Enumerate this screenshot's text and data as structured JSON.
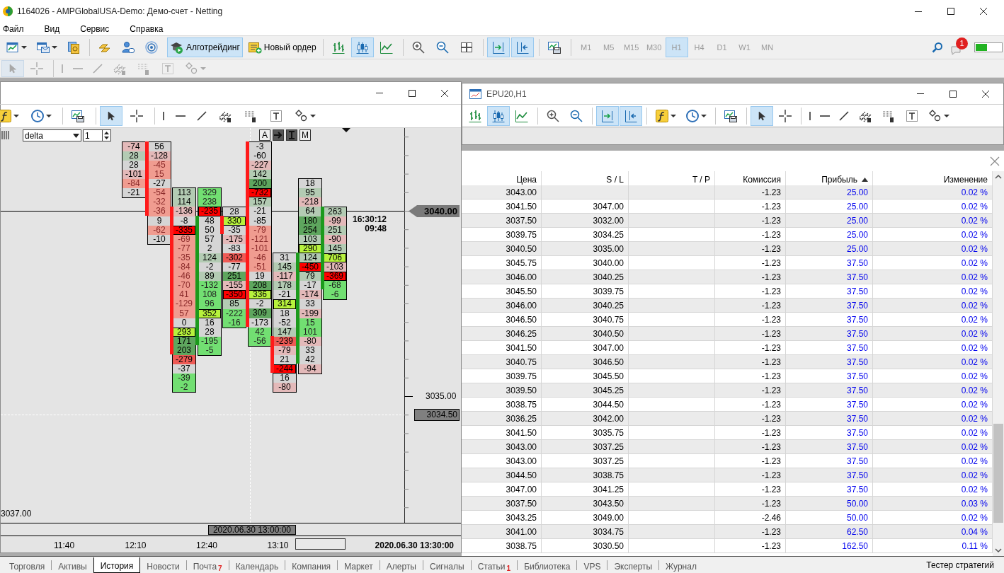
{
  "window": {
    "title": "1164026 - AMPGlobalUSA-Demo: Демо-счет - Netting"
  },
  "menu": [
    "Файл",
    "Вид",
    "Сервис",
    "Справка"
  ],
  "main_toolbar": {
    "left": [
      [
        {
          "kind": "new_chart",
          "caret": true
        },
        {
          "kind": "profiles",
          "caret": true
        },
        {
          "kind": "market"
        }
      ],
      [
        {
          "kind": "gold"
        },
        {
          "kind": "user"
        },
        {
          "kind": "waves"
        }
      ]
    ],
    "algo_button": {
      "label": "Алготрейдинг",
      "selected": true
    },
    "order_button": {
      "label": "Новый ордер"
    },
    "chart_tools": [
      [
        {
          "kind": "bars",
          "selected": false
        },
        {
          "kind": "candles",
          "selected": true
        },
        {
          "kind": "line",
          "selected": false
        }
      ],
      [
        {
          "kind": "zoom_in",
          "selected": false
        },
        {
          "kind": "zoom_out",
          "selected": false
        },
        {
          "kind": "tile",
          "selected": false
        }
      ],
      [
        {
          "kind": "autoscroll",
          "selected": true
        },
        {
          "kind": "shift",
          "selected": true
        }
      ],
      [
        {
          "kind": "template",
          "selected": false
        }
      ]
    ],
    "timeframes": [
      {
        "label": "M1",
        "selected": false,
        "disabled": true
      },
      {
        "label": "M5",
        "selected": false,
        "disabled": true
      },
      {
        "label": "M15",
        "selected": false,
        "disabled": true
      },
      {
        "label": "M30",
        "selected": false,
        "disabled": true
      },
      {
        "label": "H1",
        "selected": true,
        "disabled": true
      },
      {
        "label": "H4",
        "selected": false,
        "disabled": true
      },
      {
        "label": "D1",
        "selected": false,
        "disabled": true
      },
      {
        "label": "W1",
        "selected": false,
        "disabled": true
      },
      {
        "label": "MN",
        "selected": false,
        "disabled": true
      }
    ],
    "notification_count": "1"
  },
  "drawing_toolbar": [
    [
      {
        "kind": "cursor",
        "selected": true,
        "disabled": true
      },
      {
        "kind": "crosshair",
        "selected": false,
        "disabled": true
      }
    ],
    [
      {
        "kind": "vline",
        "selected": false,
        "disabled": true
      },
      {
        "kind": "hline",
        "selected": false,
        "disabled": true
      },
      {
        "kind": "trend",
        "selected": false,
        "disabled": true
      },
      {
        "kind": "fibo_e",
        "selected": false,
        "disabled": true
      },
      {
        "kind": "fibo_f",
        "selected": false,
        "disabled": true
      },
      {
        "kind": "text",
        "selected": false,
        "disabled": true
      },
      {
        "kind": "shapes",
        "selected": false,
        "disabled": true,
        "caret": true
      }
    ]
  ],
  "chart_window": {
    "toolbar": [
      [
        {
          "kind": "function",
          "selected": false,
          "caret": true
        },
        {
          "kind": "clock",
          "selected": false,
          "caret": true
        }
      ],
      [
        {
          "kind": "template",
          "selected": false
        }
      ],
      [
        {
          "kind": "cursor",
          "selected": true
        },
        {
          "kind": "crosshair",
          "selected": false
        }
      ],
      [
        {
          "kind": "vline",
          "selected": false
        },
        {
          "kind": "hline",
          "selected": false
        },
        {
          "kind": "trend",
          "selected": false
        },
        {
          "kind": "fibo_e",
          "selected": false
        },
        {
          "kind": "fibo_f",
          "selected": false
        },
        {
          "kind": "text",
          "selected": false
        },
        {
          "kind": "shapes",
          "selected": false,
          "caret": true
        }
      ]
    ],
    "indicator_select": "delta",
    "period": "1",
    "mode_buttons": [
      {
        "kind": "letter",
        "label": "A",
        "selected": false
      },
      {
        "kind": "arrow",
        "selected": true
      },
      {
        "kind": "ibeam",
        "selected": true
      },
      {
        "kind": "letter",
        "label": "M",
        "selected": false
      }
    ],
    "columns": [
      {
        "cells": [
          {
            "v": "-74",
            "kind": "sell"
          },
          {
            "v": "28",
            "kind": "buy"
          },
          {
            "v": "28",
            "kind": "neutral"
          },
          {
            "v": "-101",
            "kind": "sell"
          },
          {
            "v": "-84",
            "kind": "zone_sell"
          },
          {
            "v": "-21",
            "kind": "neutral"
          }
        ]
      },
      {
        "bearish": true,
        "cells": [
          {
            "v": "56",
            "kind": "neutral"
          },
          {
            "v": "-128",
            "kind": "sell"
          },
          {
            "v": "-45",
            "kind": "zone_sell"
          },
          {
            "v": "15",
            "kind": "zone_sell"
          },
          {
            "v": "-27",
            "kind": "neutral"
          },
          {
            "v": "-54",
            "kind": "zone_sell"
          },
          {
            "v": "-32",
            "kind": "zone_sell"
          },
          {
            "v": "-36",
            "kind": "zone_sell"
          },
          {
            "v": "9",
            "kind": "neutral"
          },
          {
            "v": "-62",
            "kind": "zone_sell"
          },
          {
            "v": "-10",
            "kind": "neutral"
          }
        ]
      },
      {
        "bearish": true,
        "cells": [
          {
            "v": "113",
            "kind": "buy"
          },
          {
            "v": "114",
            "kind": "buy"
          },
          {
            "v": "-136",
            "kind": "sell"
          },
          {
            "v": "-8",
            "kind": "neutral"
          },
          {
            "v": "-335",
            "kind": "max_sell"
          },
          {
            "v": "-69",
            "kind": "zone_sell"
          },
          {
            "v": "-77",
            "kind": "zone_sell"
          },
          {
            "v": "-35",
            "kind": "zone_sell"
          },
          {
            "v": "-84",
            "kind": "zone_sell"
          },
          {
            "v": "-46",
            "kind": "zone_sell"
          },
          {
            "v": "-70",
            "kind": "zone_sell"
          },
          {
            "v": "41",
            "kind": "zone_sell"
          },
          {
            "v": "-129",
            "kind": "zone_sell"
          },
          {
            "v": "57",
            "kind": "zone_sell"
          },
          {
            "v": "0",
            "kind": "neutral"
          },
          {
            "v": "293",
            "kind": "max_buy"
          },
          {
            "v": "171",
            "kind": "strong_buy"
          },
          {
            "v": "203",
            "kind": "strong_buy"
          },
          {
            "v": "-279",
            "kind": "strong_sell"
          },
          {
            "v": "-37",
            "kind": "neutral"
          },
          {
            "v": "-39",
            "kind": "zone_buy"
          },
          {
            "v": "-2",
            "kind": "zone_buy"
          }
        ]
      },
      {
        "bearish": false,
        "cells": [
          {
            "v": "329",
            "kind": "zone_buy"
          },
          {
            "v": "238",
            "kind": "zone_buy"
          },
          {
            "v": "-235",
            "kind": "max_sell"
          },
          {
            "v": "48",
            "kind": "neutral"
          },
          {
            "v": "50",
            "kind": "neutral"
          },
          {
            "v": "57",
            "kind": "neutral"
          },
          {
            "v": "2",
            "kind": "neutral"
          },
          {
            "v": "124",
            "kind": "buy"
          },
          {
            "v": "-2",
            "kind": "neutral"
          },
          {
            "v": "89",
            "kind": "buy"
          },
          {
            "v": "-132",
            "kind": "zone_buy"
          },
          {
            "v": "108",
            "kind": "zone_buy"
          },
          {
            "v": "96",
            "kind": "zone_buy"
          },
          {
            "v": "352",
            "kind": "max_buy"
          },
          {
            "v": "16",
            "kind": "neutral"
          },
          {
            "v": "28",
            "kind": "neutral"
          },
          {
            "v": "-195",
            "kind": "zone_buy"
          },
          {
            "v": "-5",
            "kind": "zone_buy"
          }
        ]
      },
      {
        "bearish": true,
        "cells": [
          {
            "v": "28",
            "kind": "neutral"
          },
          {
            "v": "330",
            "kind": "max_buy"
          },
          {
            "v": "-35",
            "kind": "neutral"
          },
          {
            "v": "-175",
            "kind": "sell"
          },
          {
            "v": "-83",
            "kind": "neutral"
          },
          {
            "v": "-302",
            "kind": "strong_sell"
          },
          {
            "v": "-77",
            "kind": "neutral"
          },
          {
            "v": "251",
            "kind": "strong_buy"
          },
          {
            "v": "-155",
            "kind": "sell"
          },
          {
            "v": "-350",
            "kind": "max_sell"
          },
          {
            "v": "85",
            "kind": "buy"
          },
          {
            "v": "-222",
            "kind": "zone_buy"
          },
          {
            "v": "-16",
            "kind": "zone_buy"
          }
        ]
      },
      {
        "bearish": true,
        "cells": [
          {
            "v": "-3",
            "kind": "neutral"
          },
          {
            "v": "-60",
            "kind": "neutral"
          },
          {
            "v": "-227",
            "kind": "sell"
          },
          {
            "v": "142",
            "kind": "buy"
          },
          {
            "v": "200",
            "kind": "strong_buy"
          },
          {
            "v": "-732",
            "kind": "max_sell"
          },
          {
            "v": "157",
            "kind": "buy"
          },
          {
            "v": "-21",
            "kind": "neutral"
          },
          {
            "v": "-85",
            "kind": "neutral"
          },
          {
            "v": "-79",
            "kind": "zone_sell"
          },
          {
            "v": "-121",
            "kind": "zone_sell"
          },
          {
            "v": "-101",
            "kind": "zone_sell"
          },
          {
            "v": "-46",
            "kind": "zone_sell"
          },
          {
            "v": "-51",
            "kind": "zone_sell"
          },
          {
            "v": "19",
            "kind": "neutral"
          },
          {
            "v": "208",
            "kind": "strong_buy"
          },
          {
            "v": "336",
            "kind": "max_buy"
          },
          {
            "v": "-2",
            "kind": "neutral"
          },
          {
            "v": "309",
            "kind": "strong_buy"
          },
          {
            "v": "-173",
            "kind": "neutral"
          },
          {
            "v": "42",
            "kind": "zone_buy"
          },
          {
            "v": "-56",
            "kind": "zone_buy"
          }
        ]
      },
      {
        "bearish": true,
        "cells": [
          {
            "v": "31",
            "kind": "neutral"
          },
          {
            "v": "145",
            "kind": "buy"
          },
          {
            "v": "-117",
            "kind": "sell"
          },
          {
            "v": "178",
            "kind": "buy"
          },
          {
            "v": "-21",
            "kind": "neutral"
          },
          {
            "v": "314",
            "kind": "max_buy"
          },
          {
            "v": "18",
            "kind": "neutral"
          },
          {
            "v": "-52",
            "kind": "neutral"
          },
          {
            "v": "147",
            "kind": "buy"
          },
          {
            "v": "-239",
            "kind": "strong_sell"
          },
          {
            "v": "-79",
            "kind": "sell"
          },
          {
            "v": "21",
            "kind": "neutral"
          },
          {
            "v": "-244",
            "kind": "max_sell"
          },
          {
            "v": "16",
            "kind": "neutral"
          },
          {
            "v": "-80",
            "kind": "sell"
          }
        ]
      },
      {
        "bearish": false,
        "cells": [
          {
            "v": "18",
            "kind": "neutral"
          },
          {
            "v": "95",
            "kind": "buy"
          },
          {
            "v": "-218",
            "kind": "sell"
          },
          {
            "v": "64",
            "kind": "buy"
          },
          {
            "v": "180",
            "kind": "strong_buy"
          },
          {
            "v": "254",
            "kind": "strong_buy"
          },
          {
            "v": "103",
            "kind": "buy"
          },
          {
            "v": "290",
            "kind": "max_buy"
          },
          {
            "v": "124",
            "kind": "buy"
          },
          {
            "v": "-450",
            "kind": "max_sell"
          },
          {
            "v": "79",
            "kind": "buy"
          },
          {
            "v": "-17",
            "kind": "neutral"
          },
          {
            "v": "-174",
            "kind": "sell"
          },
          {
            "v": "33",
            "kind": "neutral"
          },
          {
            "v": "-199",
            "kind": "sell"
          },
          {
            "v": "15",
            "kind": "zone_buy"
          },
          {
            "v": "101",
            "kind": "zone_buy"
          },
          {
            "v": "-80",
            "kind": "sell"
          },
          {
            "v": "33",
            "kind": "neutral"
          },
          {
            "v": "42",
            "kind": "neutral"
          },
          {
            "v": "-94",
            "kind": "sell"
          }
        ]
      },
      {
        "bearish": false,
        "cells": [
          {
            "v": "263",
            "kind": "buy"
          },
          {
            "v": "-99",
            "kind": "sell"
          },
          {
            "v": "251",
            "kind": "buy"
          },
          {
            "v": "-90",
            "kind": "sell"
          },
          {
            "v": "145",
            "kind": "buy"
          },
          {
            "v": "706",
            "kind": "max_buy"
          },
          {
            "v": "-103",
            "kind": "sell"
          },
          {
            "v": "-369",
            "kind": "max_sell"
          },
          {
            "v": "-68",
            "kind": "zone_buy"
          },
          {
            "v": "-6",
            "kind": "zone_buy"
          }
        ]
      }
    ],
    "bar_time": "16:30:12",
    "countdown": "09:48",
    "price_labels": [
      {
        "kind": "current",
        "price": "3040.00"
      },
      {
        "kind": "level",
        "price": "3035.00"
      },
      {
        "kind": "crosshair",
        "price": "3034.50"
      }
    ],
    "corner_label": "3037.00",
    "crosshair_time": "2020.06.30 13:00:00",
    "time_axis": [
      "11:40",
      "12:10",
      "12:40",
      "13:10"
    ],
    "end_time": "2020.06.30 13:30:00"
  },
  "second_window": {
    "title": "EPU20,H1",
    "toolbar": [
      [
        {
          "kind": "bars",
          "selected": false
        },
        {
          "kind": "candles",
          "selected": true
        },
        {
          "kind": "line",
          "selected": false
        }
      ],
      [
        {
          "kind": "zoom_in",
          "selected": false
        },
        {
          "kind": "zoom_out",
          "selected": false
        }
      ],
      [
        {
          "kind": "autoscroll",
          "selected": true
        },
        {
          "kind": "shift",
          "selected": true
        }
      ],
      [
        {
          "kind": "function",
          "selected": false,
          "caret": true
        },
        {
          "kind": "clock",
          "selected": false,
          "caret": true
        }
      ],
      [
        {
          "kind": "template",
          "selected": false
        }
      ],
      [
        {
          "kind": "cursor",
          "selected": true
        },
        {
          "kind": "crosshair",
          "selected": false
        }
      ],
      [
        {
          "kind": "vline",
          "selected": false
        },
        {
          "kind": "hline",
          "selected": false
        },
        {
          "kind": "trend",
          "selected": false
        },
        {
          "kind": "fibo_e",
          "selected": false
        },
        {
          "kind": "fibo_f",
          "selected": false
        },
        {
          "kind": "text",
          "selected": false
        },
        {
          "kind": "shapes",
          "selected": false,
          "caret": true
        }
      ]
    ]
  },
  "history_table": {
    "columns": [
      {
        "label": "Цена",
        "sorted": false
      },
      {
        "label": "S / L",
        "sorted": false
      },
      {
        "label": "T / P",
        "sorted": false
      },
      {
        "label": "Комиссия",
        "sorted": false
      },
      {
        "label": "Прибыль",
        "sorted": true
      },
      {
        "label": "Изменение",
        "sorted": false
      }
    ],
    "rows": [
      {
        "price": "3043.00",
        "commission": "-1.23",
        "profit": "25.00",
        "change": "0.02 %"
      },
      {
        "price": "3041.50",
        "sl": "3047.00",
        "commission": "-1.23",
        "profit": "25.00",
        "change": "0.02 %"
      },
      {
        "price": "3037.50",
        "sl": "3032.00",
        "commission": "-1.23",
        "profit": "25.00",
        "change": "0.02 %"
      },
      {
        "price": "3039.75",
        "sl": "3034.25",
        "commission": "-1.23",
        "profit": "25.00",
        "change": "0.02 %"
      },
      {
        "price": "3040.50",
        "sl": "3035.00",
        "commission": "-1.23",
        "profit": "25.00",
        "change": "0.02 %"
      },
      {
        "price": "3045.75",
        "sl": "3040.00",
        "commission": "-1.23",
        "profit": "37.50",
        "change": "0.02 %"
      },
      {
        "price": "3046.00",
        "sl": "3040.25",
        "commission": "-1.23",
        "profit": "37.50",
        "change": "0.02 %"
      },
      {
        "price": "3045.50",
        "sl": "3039.75",
        "commission": "-1.23",
        "profit": "37.50",
        "change": "0.02 %"
      },
      {
        "price": "3046.00",
        "sl": "3040.25",
        "commission": "-1.23",
        "profit": "37.50",
        "change": "0.02 %"
      },
      {
        "price": "3046.50",
        "sl": "3040.75",
        "commission": "-1.23",
        "profit": "37.50",
        "change": "0.02 %"
      },
      {
        "price": "3046.25",
        "sl": "3040.50",
        "commission": "-1.23",
        "profit": "37.50",
        "change": "0.02 %"
      },
      {
        "price": "3041.50",
        "sl": "3047.00",
        "commission": "-1.23",
        "profit": "37.50",
        "change": "0.02 %"
      },
      {
        "price": "3040.75",
        "sl": "3046.50",
        "commission": "-1.23",
        "profit": "37.50",
        "change": "0.02 %"
      },
      {
        "price": "3039.75",
        "sl": "3045.50",
        "commission": "-1.23",
        "profit": "37.50",
        "change": "0.02 %"
      },
      {
        "price": "3039.50",
        "sl": "3045.25",
        "commission": "-1.23",
        "profit": "37.50",
        "change": "0.02 %"
      },
      {
        "price": "3038.75",
        "sl": "3044.50",
        "commission": "-1.23",
        "profit": "37.50",
        "change": "0.02 %"
      },
      {
        "price": "3036.25",
        "sl": "3042.00",
        "commission": "-1.23",
        "profit": "37.50",
        "change": "0.02 %"
      },
      {
        "price": "3041.50",
        "sl": "3035.75",
        "commission": "-1.23",
        "profit": "37.50",
        "change": "0.02 %"
      },
      {
        "price": "3043.00",
        "sl": "3037.25",
        "commission": "-1.23",
        "profit": "37.50",
        "change": "0.02 %"
      },
      {
        "price": "3043.00",
        "sl": "3037.25",
        "commission": "-1.23",
        "profit": "37.50",
        "change": "0.02 %"
      },
      {
        "price": "3044.50",
        "sl": "3038.75",
        "commission": "-1.23",
        "profit": "37.50",
        "change": "0.02 %"
      },
      {
        "price": "3047.00",
        "sl": "3041.25",
        "commission": "-1.23",
        "profit": "37.50",
        "change": "0.02 %"
      },
      {
        "price": "3037.50",
        "sl": "3043.50",
        "commission": "-1.23",
        "profit": "50.00",
        "change": "0.03 %"
      },
      {
        "price": "3043.25",
        "sl": "3049.00",
        "commission": "-2.46",
        "profit": "50.00",
        "change": "0.02 %"
      },
      {
        "price": "3041.00",
        "sl": "3034.75",
        "commission": "-1.23",
        "profit": "62.50",
        "change": "0.04 %"
      },
      {
        "price": "3038.75",
        "sl": "3030.50",
        "commission": "-1.23",
        "profit": "162.50",
        "change": "0.11 %"
      }
    ]
  },
  "bottom_tabs": [
    {
      "label": "Торговля",
      "selected": false
    },
    {
      "label": "Активы",
      "selected": false
    },
    {
      "label": "История",
      "selected": true
    },
    {
      "label": "Новости",
      "selected": false
    },
    {
      "label": "Почта",
      "selected": false,
      "badge": "7"
    },
    {
      "label": "Календарь",
      "selected": false
    },
    {
      "label": "Компания",
      "selected": false
    },
    {
      "label": "Маркет",
      "selected": false
    },
    {
      "label": "Алерты",
      "selected": false
    },
    {
      "label": "Сигналы",
      "selected": false
    },
    {
      "label": "Статьи",
      "selected": false,
      "badge": "1"
    },
    {
      "label": "Библиотека",
      "selected": false
    },
    {
      "label": "VPS",
      "selected": false
    },
    {
      "label": "Эксперты",
      "selected": false
    },
    {
      "label": "Журнал",
      "selected": false
    }
  ],
  "tester_tab": "Тестер стратегий"
}
